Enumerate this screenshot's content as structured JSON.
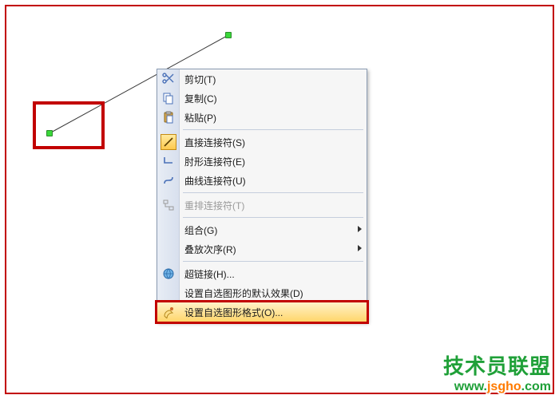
{
  "menu": {
    "cut": "剪切(T)",
    "copy": "复制(C)",
    "paste": "粘贴(P)",
    "straight_connector": "直接连接符(S)",
    "elbow_connector": "肘形连接符(E)",
    "curve_connector": "曲线连接符(U)",
    "reroute_connectors": "重排连接符(T)",
    "group": "组合(G)",
    "order": "叠放次序(R)",
    "hyperlink": "超链接(H)...",
    "set_default": "设置自选图形的默认效果(D)",
    "format_autoshape": "设置自选图形格式(O)..."
  },
  "watermark": {
    "line1": "技术员联盟",
    "line2_a": "www.",
    "line2_b": "jsgho",
    "line2_c": ".com"
  }
}
